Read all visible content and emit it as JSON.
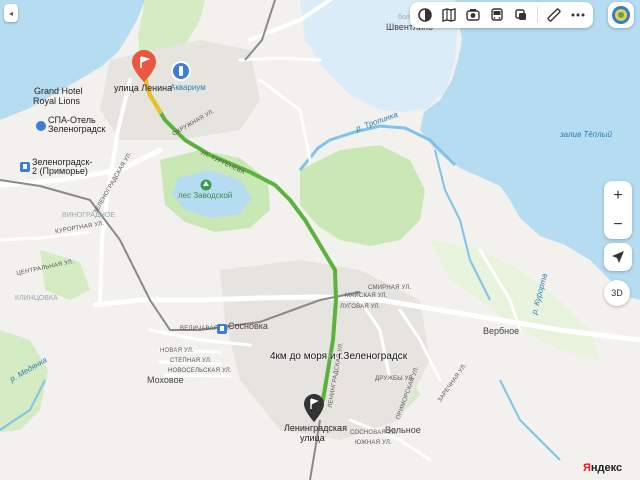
{
  "ui": {
    "back_label": "◂",
    "zoom_in": "+",
    "zoom_out": "−",
    "threed_label": "3D",
    "logo_first": "Я",
    "logo_rest": "ндекс",
    "toolbar_icons": [
      "layers-icon",
      "map-book-icon",
      "camera-icon",
      "bus-icon",
      "copy-icon",
      "ruler-icon",
      "more-icon"
    ]
  },
  "route": {
    "label": "4км до моря и г.Зеленоградск",
    "start_name": "улица Ленина",
    "end_name_line1": "Ленинградская",
    "end_name_line2": "улица",
    "start_pin_color": "#e9573f",
    "end_pin_color": "#333333",
    "line_color": "#5bb33a"
  },
  "colors": {
    "sea": "#b6dcf2",
    "land": "#f2f1ee",
    "forest": "#c9e8b5",
    "road": "#ffffff",
    "river": "#7fc3ea"
  },
  "labels": {
    "bol": "бол.",
    "shvent": "Швентлино",
    "grand_hotel": "Grand Hotel",
    "royal_lions": "Royal Lions",
    "spa1": "СПА-Отель",
    "spa2": "Зеленоградск",
    "station1": "Зеленоградск-",
    "station2": "2 (Приморье)",
    "aquarium": "Аквариум",
    "zaliv": "залив Тёплый",
    "tropinka": "р. Тропинка",
    "les": "лес Заводской",
    "sosnovka": "Сосновка",
    "verbnoe": "Вербное",
    "mokhovoe": "Моховое",
    "volnoe": "Вольное",
    "kurpinovka": "р. Медянка",
    "kurortnaya": "КУРОРТНАЯ УЛ.",
    "okruzhnaya": "ОКРУЖНАЯ УЛ.",
    "turgeneva": "УЛ. ТУРГЕНЕВА",
    "zelenogradskaya": "ЗЕЛЕНОГРАДСКАЯ УЛ.",
    "tsentralnaya": "ЦЕНТРАЛЬНАЯ УЛ.",
    "velichavaya": "ВЕЛИЧАВАЯ УЛ.",
    "novaya": "НОВАЯ УЛ.",
    "stepnaya": "СТЕПНАЯ УЛ.",
    "novoselskaya": "НОВОСЕЛЬСКАЯ УЛ.",
    "mayskaya": "МАЙСКАЯ УЛ.",
    "smirnaya": "СМИРНАЯ УЛ.",
    "lugovaya": "ЛУГОВАЯ УЛ.",
    "klinchovka": "КЛИНЦОВКА",
    "vinyaznoe": "ВИНОГРАДНОЕ",
    "leningradskaya": "ЛЕНИНГРАДСКАЯ УЛ.",
    "druzhby": "ДРУЖБЫ УЛ.",
    "kurortnaya2": "р. Курорта",
    "yuzhnaya": "ЮЖНАЯ УЛ.",
    "sosnovaya": "СОСНОВАЯ УЛ.",
    "primorskaya": "ПРИМОРСКАЯ УЛ.",
    "rybnaya": "ЗАРЕЧНАЯ УЛ."
  }
}
